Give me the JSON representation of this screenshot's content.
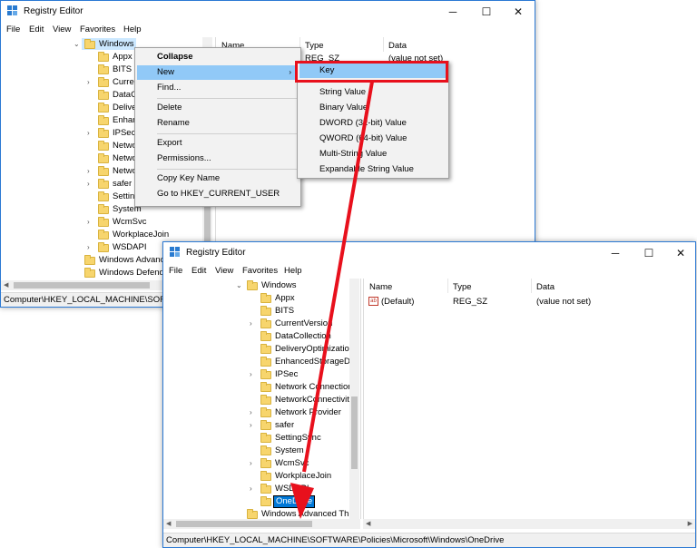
{
  "colors": {
    "accent": "#2b79d4",
    "selection": "#91c9f7",
    "annotation_red": "#e8101c",
    "folder": "#f7d56d"
  },
  "window1": {
    "title": "Registry Editor",
    "controls": {
      "minimize": "─",
      "maximize": "☐",
      "close": "✕"
    },
    "menu": [
      "File",
      "Edit",
      "View",
      "Favorites",
      "Help"
    ],
    "tree": [
      "Windows",
      "Appx",
      "BITS",
      "Curren",
      "DataCo",
      "Delive",
      "Enhan",
      "IPSec",
      "Netwo",
      "Netwo",
      "Netwo",
      "safer",
      "Settin",
      "System",
      "WcmSvc",
      "WorkplaceJoin",
      "WSDAPI",
      "Windows Advanc",
      "Windows Defende"
    ],
    "columns": {
      "name": "Name",
      "type": "Type",
      "data": "Data"
    },
    "row": {
      "type": "REG_SZ",
      "data": "(value not set)"
    },
    "status": "Computer\\HKEY_LOCAL_MACHINE\\SOFTWA"
  },
  "context_menu": {
    "items": [
      "Collapse",
      "New",
      "Find...",
      "Delete",
      "Rename",
      "Export",
      "Permissions...",
      "Copy Key Name",
      "Go to HKEY_CURRENT_USER"
    ]
  },
  "submenu": {
    "items": [
      "Key",
      "String Value",
      "Binary Value",
      "DWORD (32-bit) Value",
      "QWORD (64-bit) Value",
      "Multi-String Value",
      "Expandable String Value"
    ]
  },
  "window2": {
    "title": "Registry Editor",
    "controls": {
      "minimize": "─",
      "maximize": "☐",
      "close": "✕"
    },
    "menu": [
      "File",
      "Edit",
      "View",
      "Favorites",
      "Help"
    ],
    "tree": [
      "Windows",
      "Appx",
      "BITS",
      "CurrentVersion",
      "DataCollection",
      "DeliveryOptimization",
      "EnhancedStorageDe",
      "IPSec",
      "Network Connection",
      "NetworkConnectivit",
      "Network Provider",
      "safer",
      "SettingSync",
      "System",
      "WcmSvc",
      "WorkplaceJoin",
      "WSDAPI",
      "OneDrive",
      "Windows Advanced Thr"
    ],
    "columns": {
      "name": "Name",
      "type": "Type",
      "data": "Data"
    },
    "rows": [
      {
        "name": "(Default)",
        "type": "REG_SZ",
        "data": "(value not set)",
        "icon": "ab"
      }
    ],
    "status": "Computer\\HKEY_LOCAL_MACHINE\\SOFTWARE\\Policies\\Microsoft\\Windows\\OneDrive"
  }
}
